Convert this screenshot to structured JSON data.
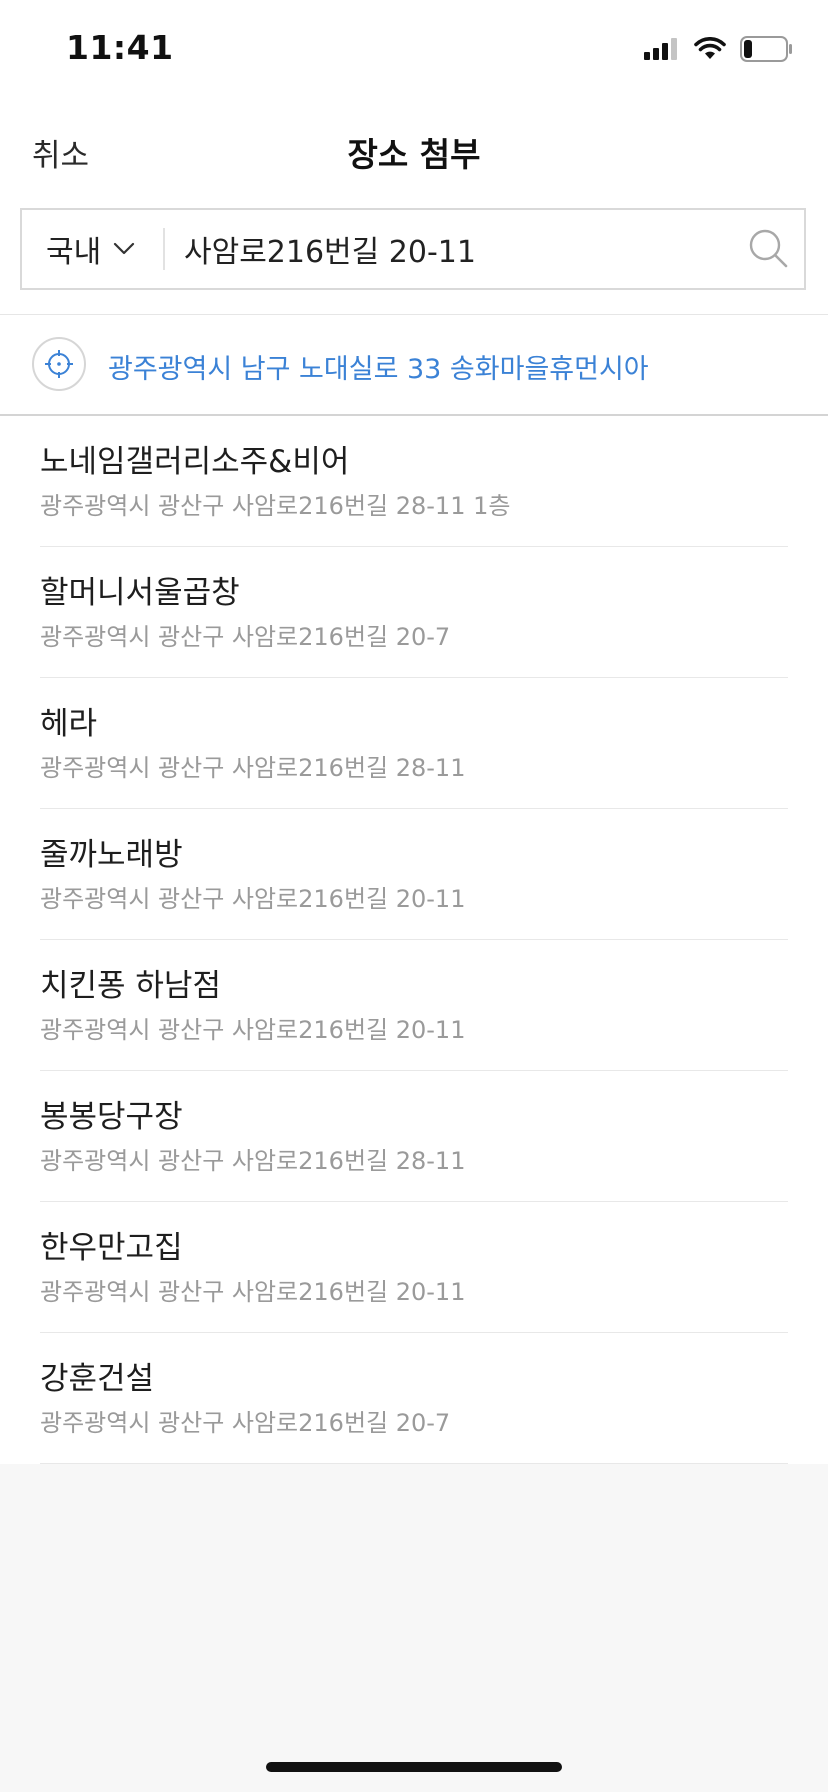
{
  "status_bar": {
    "time": "11:41",
    "icons": [
      "cellular-signal-icon",
      "wifi-icon",
      "battery-icon"
    ],
    "battery_level_fraction": 0.2
  },
  "header": {
    "cancel_label": "취소",
    "title": "장소 첨부"
  },
  "search": {
    "region_label": "국내",
    "region_icon": "chevron-down-icon",
    "query": "사암로216번길 20-11",
    "search_icon": "search-icon"
  },
  "current_location": {
    "icon": "crosshair-icon",
    "address": "광주광역시 남구 노대실로 33 송화마을휴먼시아",
    "color": "#3b82d6"
  },
  "places": [
    {
      "name": "노네임갤러리소주&비어",
      "address": "광주광역시 광산구 사암로216번길 28-11 1층"
    },
    {
      "name": "할머니서울곱창",
      "address": "광주광역시 광산구 사암로216번길 20-7"
    },
    {
      "name": "헤라",
      "address": "광주광역시 광산구 사암로216번길 28-11"
    },
    {
      "name": "줄까노래방",
      "address": "광주광역시 광산구 사암로216번길 20-11"
    },
    {
      "name": "치킨퐁 하남점",
      "address": "광주광역시 광산구 사암로216번길 20-11"
    },
    {
      "name": "봉봉당구장",
      "address": "광주광역시 광산구 사암로216번길 28-11"
    },
    {
      "name": "한우만고집",
      "address": "광주광역시 광산구 사암로216번길 20-11"
    },
    {
      "name": "강훈건설",
      "address": "광주광역시 광산구 사암로216번길 20-7"
    }
  ]
}
